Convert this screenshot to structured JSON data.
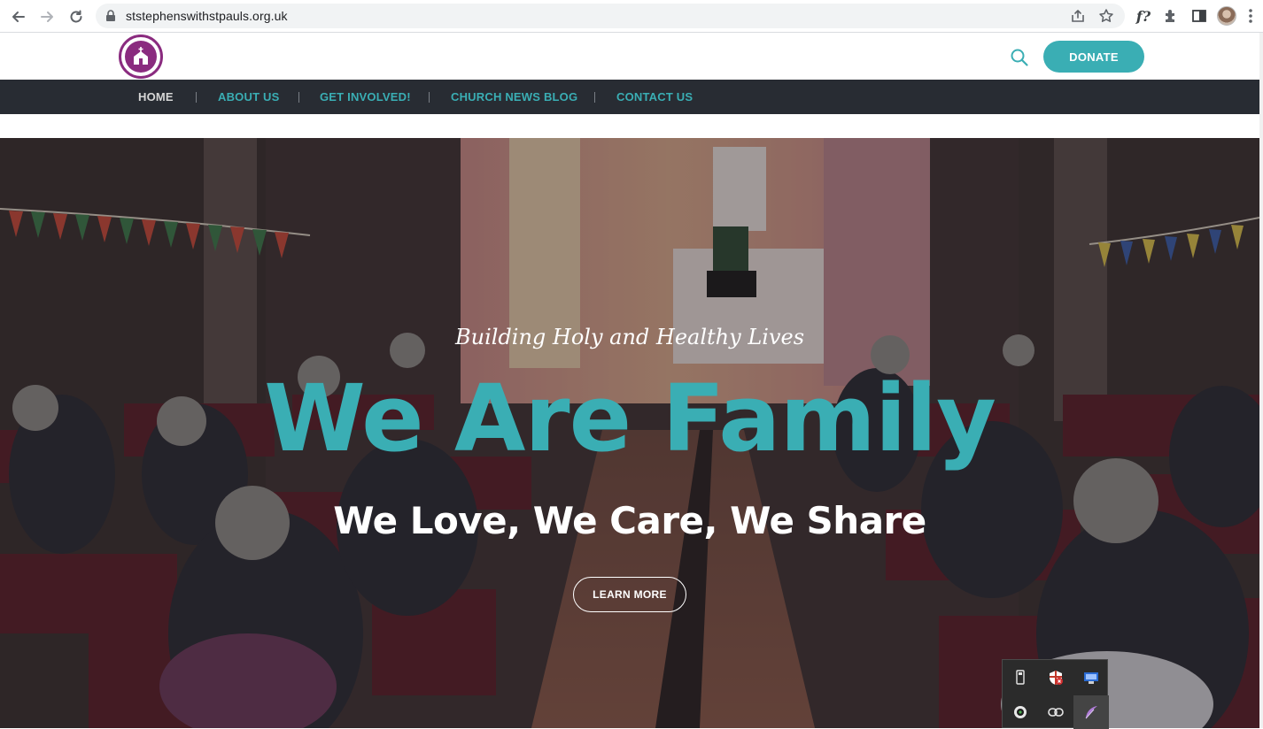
{
  "browser": {
    "url": "ststephenswithstpauls.org.uk",
    "extension_icon_label": "f?",
    "icons": [
      "back-arrow-icon",
      "forward-arrow-icon",
      "reload-icon",
      "lock-icon",
      "share-icon",
      "bookmark-star-icon",
      "puzzle-extensions-icon",
      "side-panel-icon",
      "profile-avatar",
      "kebab-menu-icon"
    ]
  },
  "header": {
    "logo_icon": "church-logo",
    "search_icon": "search-icon",
    "donate_label": "DONATE"
  },
  "nav": {
    "items": [
      {
        "label": "HOME",
        "active": true
      },
      {
        "label": "ABOUT US",
        "active": false
      },
      {
        "label": "GET INVOLVED!",
        "active": false
      },
      {
        "label": "CHURCH NEWS BLOG",
        "active": false
      },
      {
        "label": "CONTACT US",
        "active": false
      }
    ]
  },
  "hero": {
    "tagline": "Building Holy and Healthy Lives",
    "headline": "We Are Family",
    "subheadline": "We Love, We Care, We Share",
    "cta_label": "LEARN MORE"
  },
  "tray": {
    "icons": [
      "usb-drive-icon",
      "shield-alert-icon",
      "network-monitor-icon",
      "webcam-icon",
      "link-icon",
      "feather-pen-icon"
    ]
  },
  "colors": {
    "accent": "#3aaeb4",
    "navbar": "#282c33",
    "brand_purple": "#8a2b7f"
  }
}
